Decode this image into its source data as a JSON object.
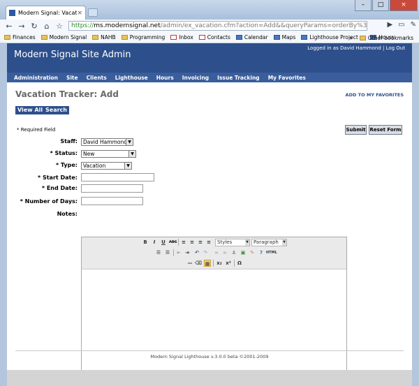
{
  "browser": {
    "tab_title": "Modern Signal: Vacation ...",
    "tab_close": "×",
    "window_buttons": {
      "minimize": "–",
      "maximize": "□",
      "close": "×"
    },
    "address": {
      "scheme": "https://",
      "host": "ms.modernsignal.net",
      "path": "/admin/ex_vacation.cfm?action=Add&&queryParams=orderBy%3DEX%255FVaca"
    },
    "bookmarks": [
      {
        "label": "Finances",
        "icon": "folder-icon"
      },
      {
        "label": "Modern Signal",
        "icon": "folder-icon"
      },
      {
        "label": "NAHB",
        "icon": "folder-icon"
      },
      {
        "label": "Programming",
        "icon": "folder-icon"
      },
      {
        "label": "Inbox",
        "icon": "gmail-icon"
      },
      {
        "label": "Contacts",
        "icon": "gmail-icon"
      },
      {
        "label": "Calendar",
        "icon": "calendar-icon"
      },
      {
        "label": "Maps",
        "icon": "maps-icon"
      },
      {
        "label": "Lighthouse Project ...",
        "icon": "page-icon"
      },
      {
        "label": "Hours",
        "icon": "page-icon"
      }
    ],
    "bookmarks_more": "»",
    "other_bookmarks": "Other bookmarks"
  },
  "header": {
    "site_title": "Modern Signal Site Admin",
    "login_status": "Logged in as David Hammond | Log Out"
  },
  "nav": [
    "Administration",
    "Site",
    "Clients",
    "Lighthouse",
    "Hours",
    "Invoicing",
    "Issue Tracking",
    "My Favorites"
  ],
  "page": {
    "title": "Vacation Tracker: Add",
    "favorites_link": "ADD TO MY FAVORITES",
    "view_all": "View All",
    "search": "Search",
    "required_note": "* Required Field",
    "submit": "Submit",
    "reset": "Reset Form"
  },
  "form": {
    "staff_label": "Staff:",
    "staff_value": "David Hammond",
    "status_label": "* Status:",
    "status_value": "New",
    "type_label": "* Type:",
    "type_value": "Vacation",
    "start_label": "* Start Date:",
    "end_label": "* End Date:",
    "days_label": "* Number of Days:",
    "notes_label": "Notes:"
  },
  "editor": {
    "bold": "B",
    "italic": "I",
    "underline": "U",
    "strike": "ABC",
    "styles": "Styles",
    "paragraph": "Paragraph",
    "subscript": "x₂",
    "superscript": "x²",
    "omega": "Ω"
  },
  "footer": "Modern Signal Lighthouse v.3.0.0 beta ©2001-2009"
}
